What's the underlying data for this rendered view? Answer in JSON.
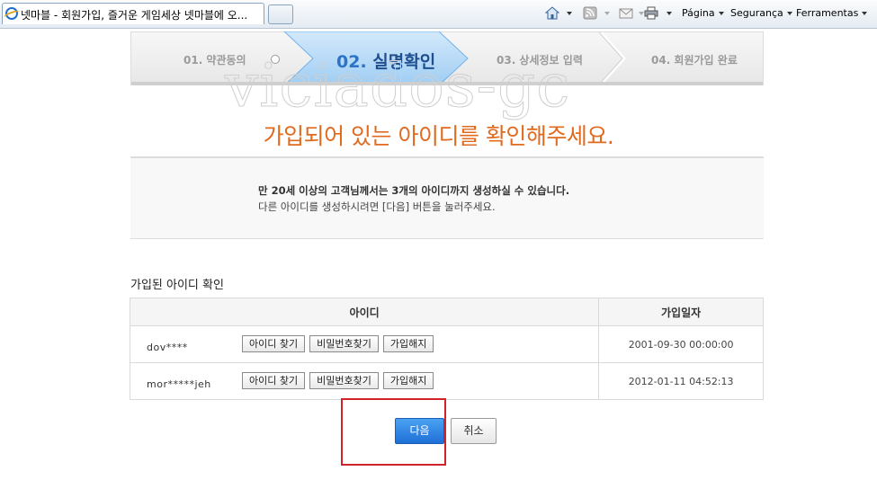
{
  "browser": {
    "tab_title": "넷마블 - 회원가입, 즐거운 게임세상 넷마블에 오...",
    "menus": {
      "page": "Página",
      "security": "Segurança",
      "tools": "Ferramentas"
    },
    "icons": [
      "home-icon",
      "feeds-icon",
      "mail-icon",
      "print-icon"
    ]
  },
  "steps": {
    "step1": "01. 약관동의",
    "step2_num": "02.",
    "step2_label": "실명확인",
    "step3": "03. 상세정보 입력",
    "step4": "04. 회원가입 완료",
    "active_color": "#2b74c8"
  },
  "watermark": "viciados-gc",
  "headline": "가입되어 있는 아이디를 확인해주세요.",
  "notice": {
    "line1": "만 20세 이상의 고객님께서는 3개의 아이디까지 생성하실 수 있습니다.",
    "line2": "다른 아이디를 생성하시려면 [다음] 버튼을 눌러주세요."
  },
  "section_title": "가입된 아이디 확인",
  "table": {
    "headers": {
      "id": "아이디",
      "date": "가입일자"
    },
    "rows": [
      {
        "id": "dov****",
        "find_id": "아이디 찾기",
        "find_pw": "비밀번호찾기",
        "cancel": "가입해지",
        "date": "2001-09-30 00:00:00"
      },
      {
        "id": "mor*****jeh",
        "find_id": "아이디 찾기",
        "find_pw": "비밀번호찾기",
        "cancel": "가입해지",
        "date": "2012-01-11 04:52:13"
      }
    ]
  },
  "buttons": {
    "next": "다음",
    "cancel": "취소"
  },
  "colors": {
    "headline": "#e06b1f",
    "next_button": "#1f6fd6",
    "highlight": "#d0232a"
  }
}
